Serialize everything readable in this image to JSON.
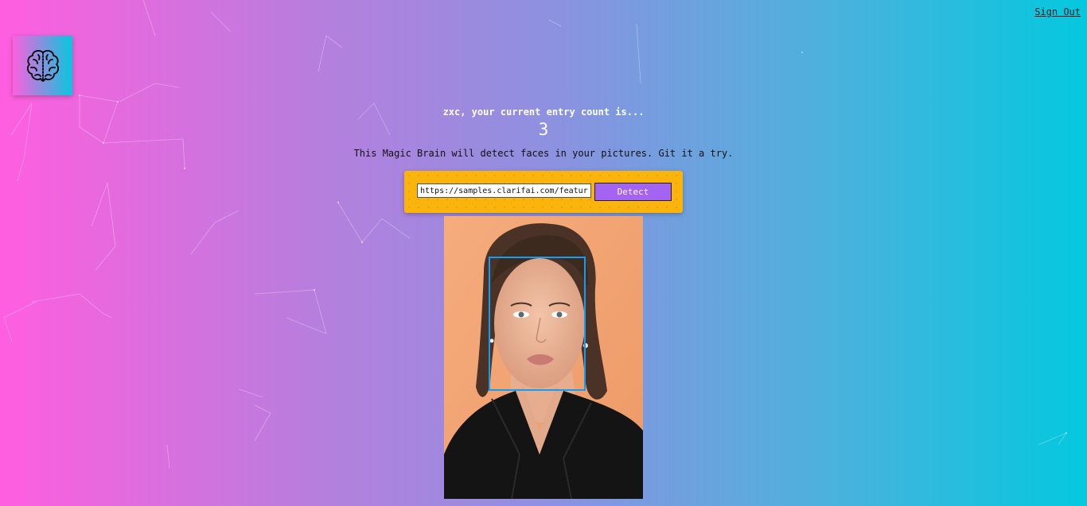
{
  "nav": {
    "sign_out_label": "Sign Out"
  },
  "logo": {
    "icon": "brain-icon"
  },
  "rank": {
    "message": "zxc, your current entry count is...",
    "count": "3"
  },
  "tagline": "This Magic Brain will detect faces in your pictures. Git it a try.",
  "image_form": {
    "input_value": "https://samples.clarifai.com/featured-models/face-celebrity-jennifer-aniston.jpg",
    "detect_label": "Detect"
  },
  "face_recognition": {
    "image_alt": "portrait photo",
    "faces_detected": 1,
    "box_color": "#149df2"
  },
  "colors": {
    "gradient_start": "#ff5edf",
    "gradient_end": "#04c8de",
    "form_background": "#fbb40c",
    "button": "#a463f2"
  }
}
